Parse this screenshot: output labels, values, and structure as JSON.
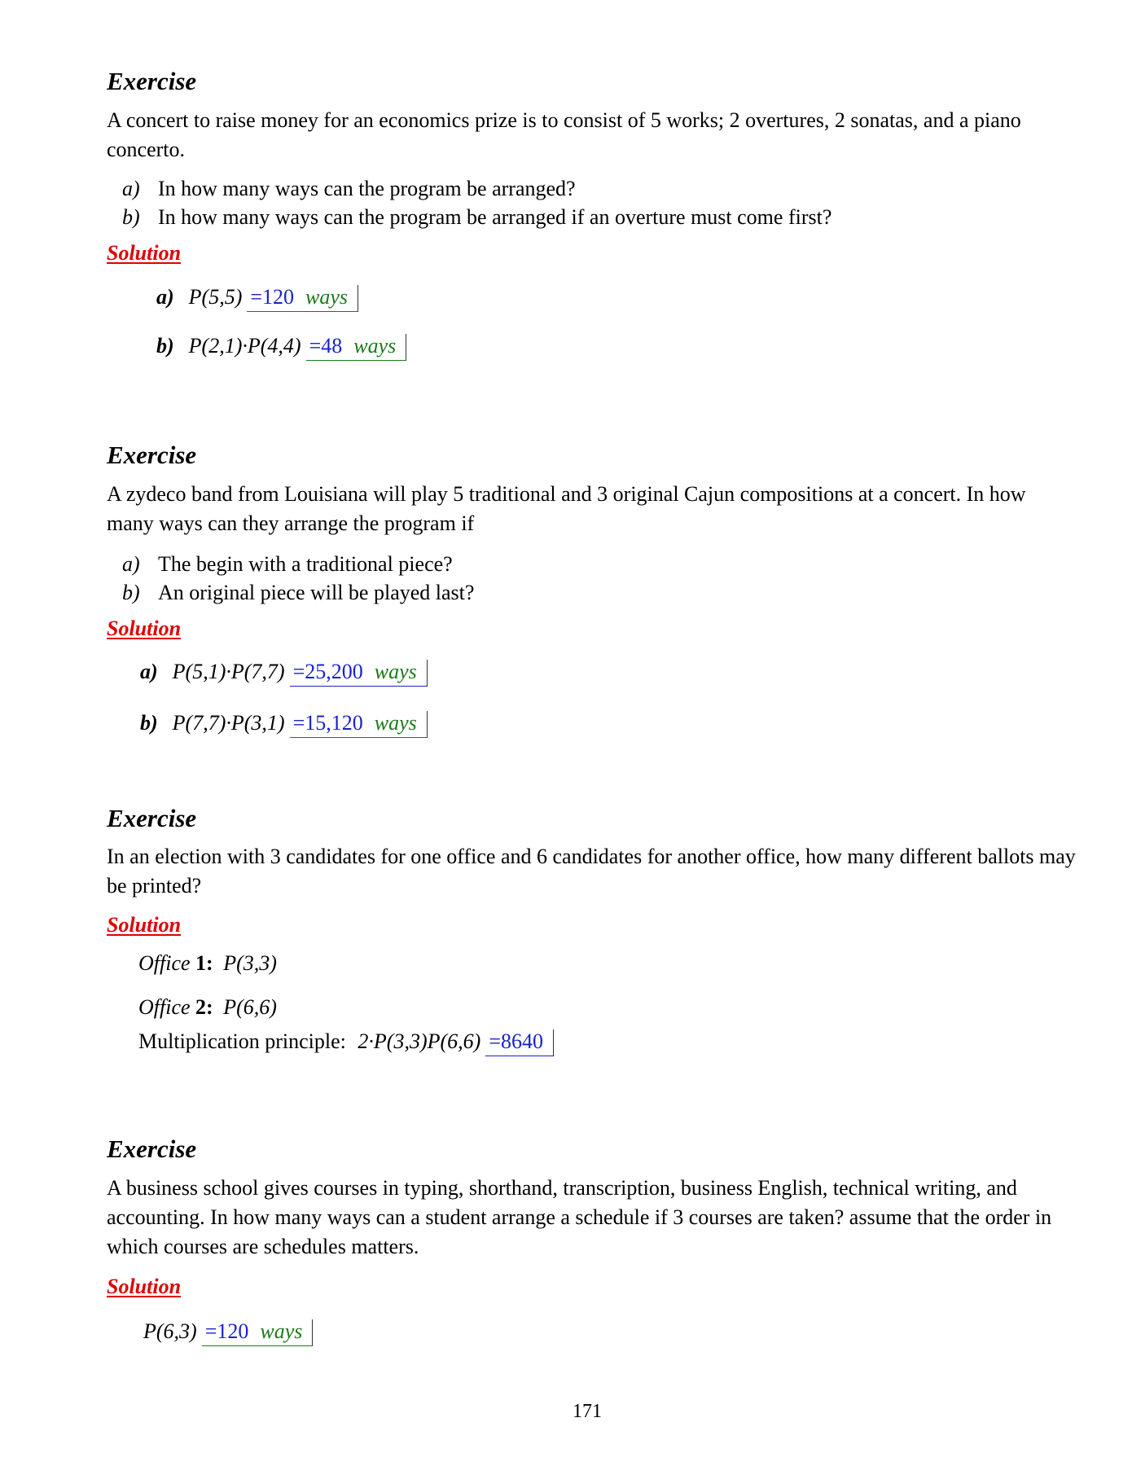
{
  "exercises": [
    {
      "heading": "Exercise",
      "text": "A concert to raise money for an economics prize is to consist of 5 works; 2 overtures, 2 sonatas, and a piano concerto.",
      "items": [
        {
          "label": "a)",
          "text": "In how many ways can the program be arranged?"
        },
        {
          "label": "b)",
          "text": "In how many ways can the program be arranged if an overture must come first?"
        }
      ],
      "solution_label": "Solution",
      "solution": [
        {
          "part": "a)",
          "expr": "P(5,5)",
          "eq": "=",
          "value": "120",
          "unit": "ways"
        },
        {
          "part": "b)",
          "expr": "P(2,1)·P(4,4)",
          "eq": "=",
          "value": "48",
          "unit": "ways"
        }
      ]
    },
    {
      "heading": "Exercise",
      "text": "A zydeco band from Louisiana will play 5 traditional and 3 original Cajun compositions at a concert. In how many ways can they arrange the program if",
      "items": [
        {
          "label": "a)",
          "text": "The begin with a traditional piece?"
        },
        {
          "label": "b)",
          "text": "An original piece will be played last?"
        }
      ],
      "solution_label": "Solution",
      "solution": [
        {
          "part": "a)",
          "expr": "P(5,1)·P(7,7)",
          "eq": "=",
          "value": "25,200",
          "unit": "ways"
        },
        {
          "part": "b)",
          "expr": "P(7,7)·P(3,1)",
          "eq": "=",
          "value": "15,120",
          "unit": "ways"
        }
      ]
    },
    {
      "heading": "Exercise",
      "text": "In an election with 3 candidates for one office and 6 candidates for another office, how many different ballots may be printed?",
      "solution_label": "Solution",
      "office1_word": "Office",
      "office1_num": "1:",
      "office1_expr": "P(3,3)",
      "office2_word": "Office",
      "office2_num": "2:",
      "office2_expr": "P(6,6)",
      "mult_label": "Multiplication principle:",
      "mult_expr": "2·P(3,3)P(6,6)",
      "mult_eq": "=",
      "mult_value": "8640"
    },
    {
      "heading": "Exercise",
      "text": "A business school gives courses in typing, shorthand, transcription, business English, technical writing, and accounting. In how many ways can a student arrange a schedule if 3 courses are taken? assume that the order in which courses are schedules matters.",
      "solution_label": "Solution",
      "expr": "P(6,3)",
      "eq": "=",
      "value": "120",
      "unit": "ways"
    }
  ],
  "page_number": "171"
}
